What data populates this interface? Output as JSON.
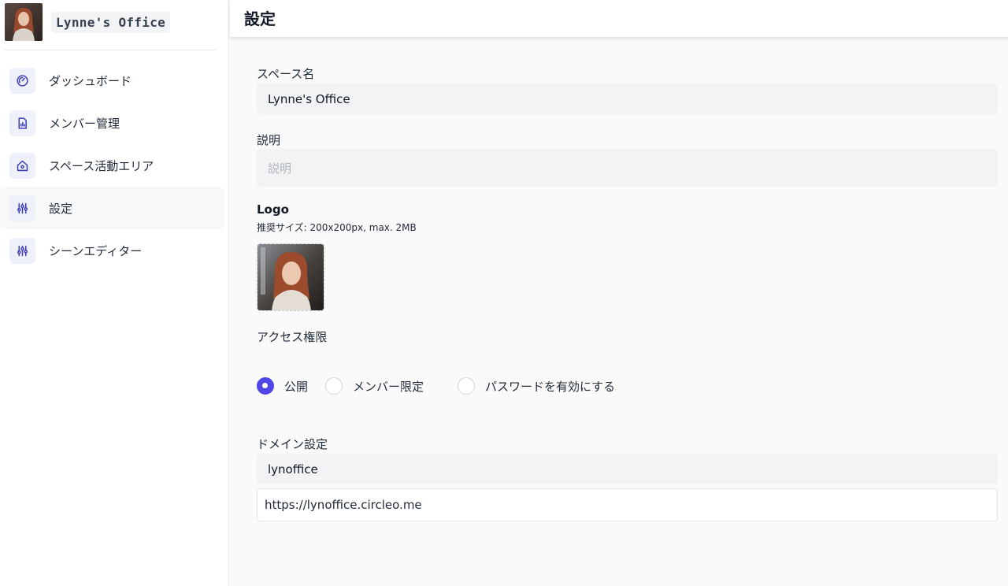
{
  "sidebar": {
    "brand_name": "Lynne's Office",
    "items": [
      {
        "label": "ダッシュボード",
        "icon": "gauge-icon"
      },
      {
        "label": "メンバー管理",
        "icon": "document-chart-icon"
      },
      {
        "label": "スペース活動エリア",
        "icon": "home-icon"
      },
      {
        "label": "設定",
        "icon": "sliders-icon",
        "active": true
      },
      {
        "label": "シーンエディター",
        "icon": "sliders-icon"
      }
    ]
  },
  "header": {
    "title": "設定"
  },
  "form": {
    "space_name_label": "スペース名",
    "space_name_value": "Lynne's Office",
    "description_label": "説明",
    "description_placeholder": "説明",
    "logo_label": "Logo",
    "logo_hint": "推奨サイズ: 200x200px, max. 2MB",
    "access_label": "アクセス権限",
    "access_options": [
      {
        "label": "公開",
        "checked": true
      },
      {
        "label": "メンバー限定",
        "checked": false
      },
      {
        "label": "パスワードを有効にする",
        "checked": false
      }
    ],
    "domain_label": "ドメイン設定",
    "domain_value": "lynoffice",
    "domain_url": "https://lynoffice.circleo.me"
  },
  "colors": {
    "accent": "#4f46e5",
    "icon_bg": "#eef0fa",
    "input_bg": "#f2f3f5"
  }
}
